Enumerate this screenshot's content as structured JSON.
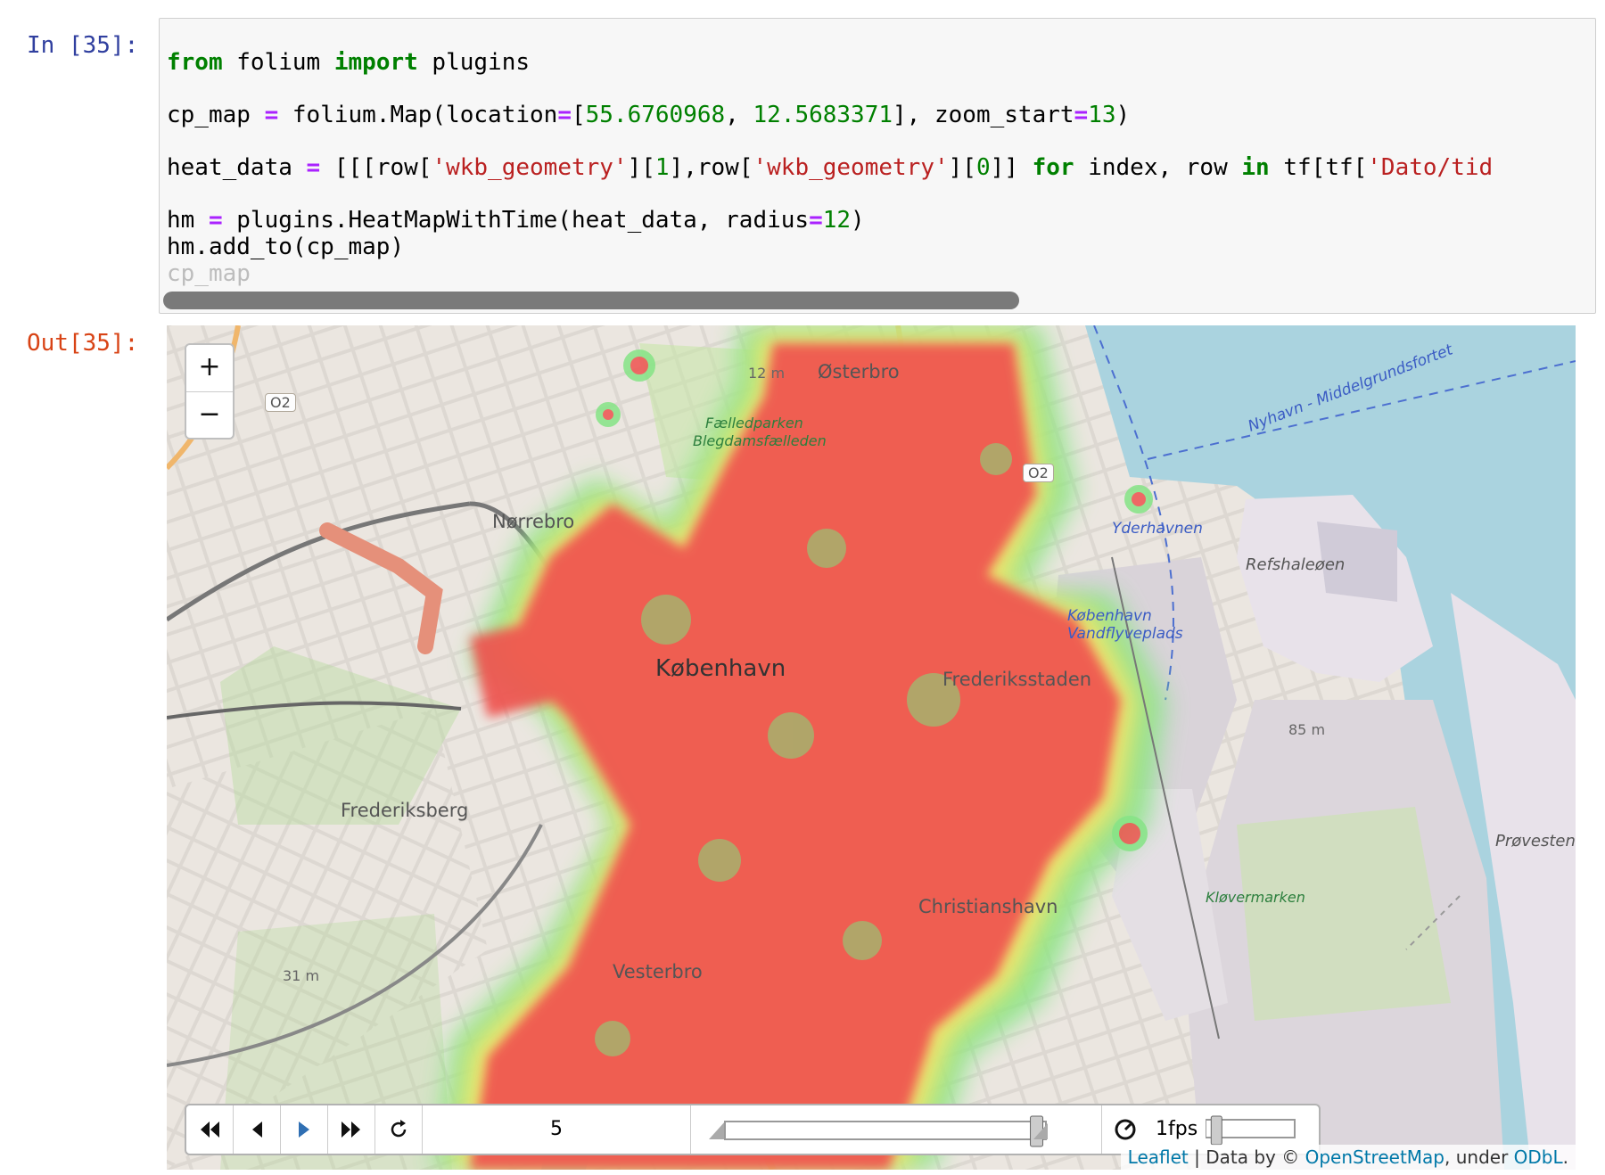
{
  "cell": {
    "in_prompt": "In [35]:",
    "out_prompt": "Out[35]:",
    "code": {
      "line1": {
        "kw1": "from",
        "mod": " folium ",
        "kw2": "import",
        "name": " plugins"
      },
      "line2": {
        "a": "cp_map ",
        "eq": "=",
        "b": " folium.Map(location",
        "eq2": "=",
        "c": "[",
        "n1": "55.6760968",
        "d": ", ",
        "n2": "12.5683371",
        "e": "], zoom_start",
        "eq3": "=",
        "n3": "13",
        "f": ")"
      },
      "line3": {
        "a": "heat_data ",
        "eq": "=",
        "b": " [[[row[",
        "s1": "'wkb_geometry'",
        "c": "][",
        "n1": "1",
        "d": "],row[",
        "s2": "'wkb_geometry'",
        "e": "][",
        "n2": "0",
        "f": "]] ",
        "kw1": "for",
        "g": " index, row ",
        "kw2": "in",
        "h": " tf[tf[",
        "s3": "'Dato/tid"
      },
      "line4": {
        "a": "hm ",
        "eq": "=",
        "b": " plugins.HeatMapWithTime(heat_data, radius",
        "eq2": "=",
        "n": "12",
        "c": ")"
      },
      "line5": "hm.add_to(cp_map)",
      "line6": "cp_map"
    }
  },
  "map": {
    "labels": {
      "osterbro": "Østerbro",
      "norrebro": "Nørrebro",
      "kobenhavn": "København",
      "frederiksstaden": "Frederiksstaden",
      "frederiksberg": "Frederiksberg",
      "christianshavn": "Christianshavn",
      "vesterbro": "Vesterbro",
      "refshaleoen": "Refshaleøen",
      "nyhavn": "Nyhavn - Middelgrundsfortet",
      "yderhavnen": "Yderhavnen",
      "vandflyveplads1": "København",
      "vandflyveplads2": "Vandflyveplads",
      "faelledparken": "Fælledparken",
      "blegdam": "Blegdamsfælleden",
      "klovermarken": "Kløvermarken",
      "provesten": "Prøvesten",
      "elev1": "12 m",
      "elev2": "85 m",
      "elev3": "31 m",
      "road1": "O2",
      "road2": "O2"
    },
    "zoom_in": "+",
    "zoom_out": "−",
    "player": {
      "time_value": "5",
      "fps": "1fps",
      "time_progress": 0.99,
      "fps_progress": 0.05
    },
    "attribution": {
      "leaflet": "Leaflet",
      "sep": " | Data by © ",
      "osm": "OpenStreetMap",
      "under": ", under ",
      "odbl": "ODbL",
      "end": "."
    },
    "colors": {
      "land": "#f2efe9",
      "water": "#aad3df",
      "heat_core": "#ef5350",
      "heat_mid": "#ffeb3b",
      "heat_edge": "#7ee07e",
      "park": "#c8e6a9"
    }
  }
}
